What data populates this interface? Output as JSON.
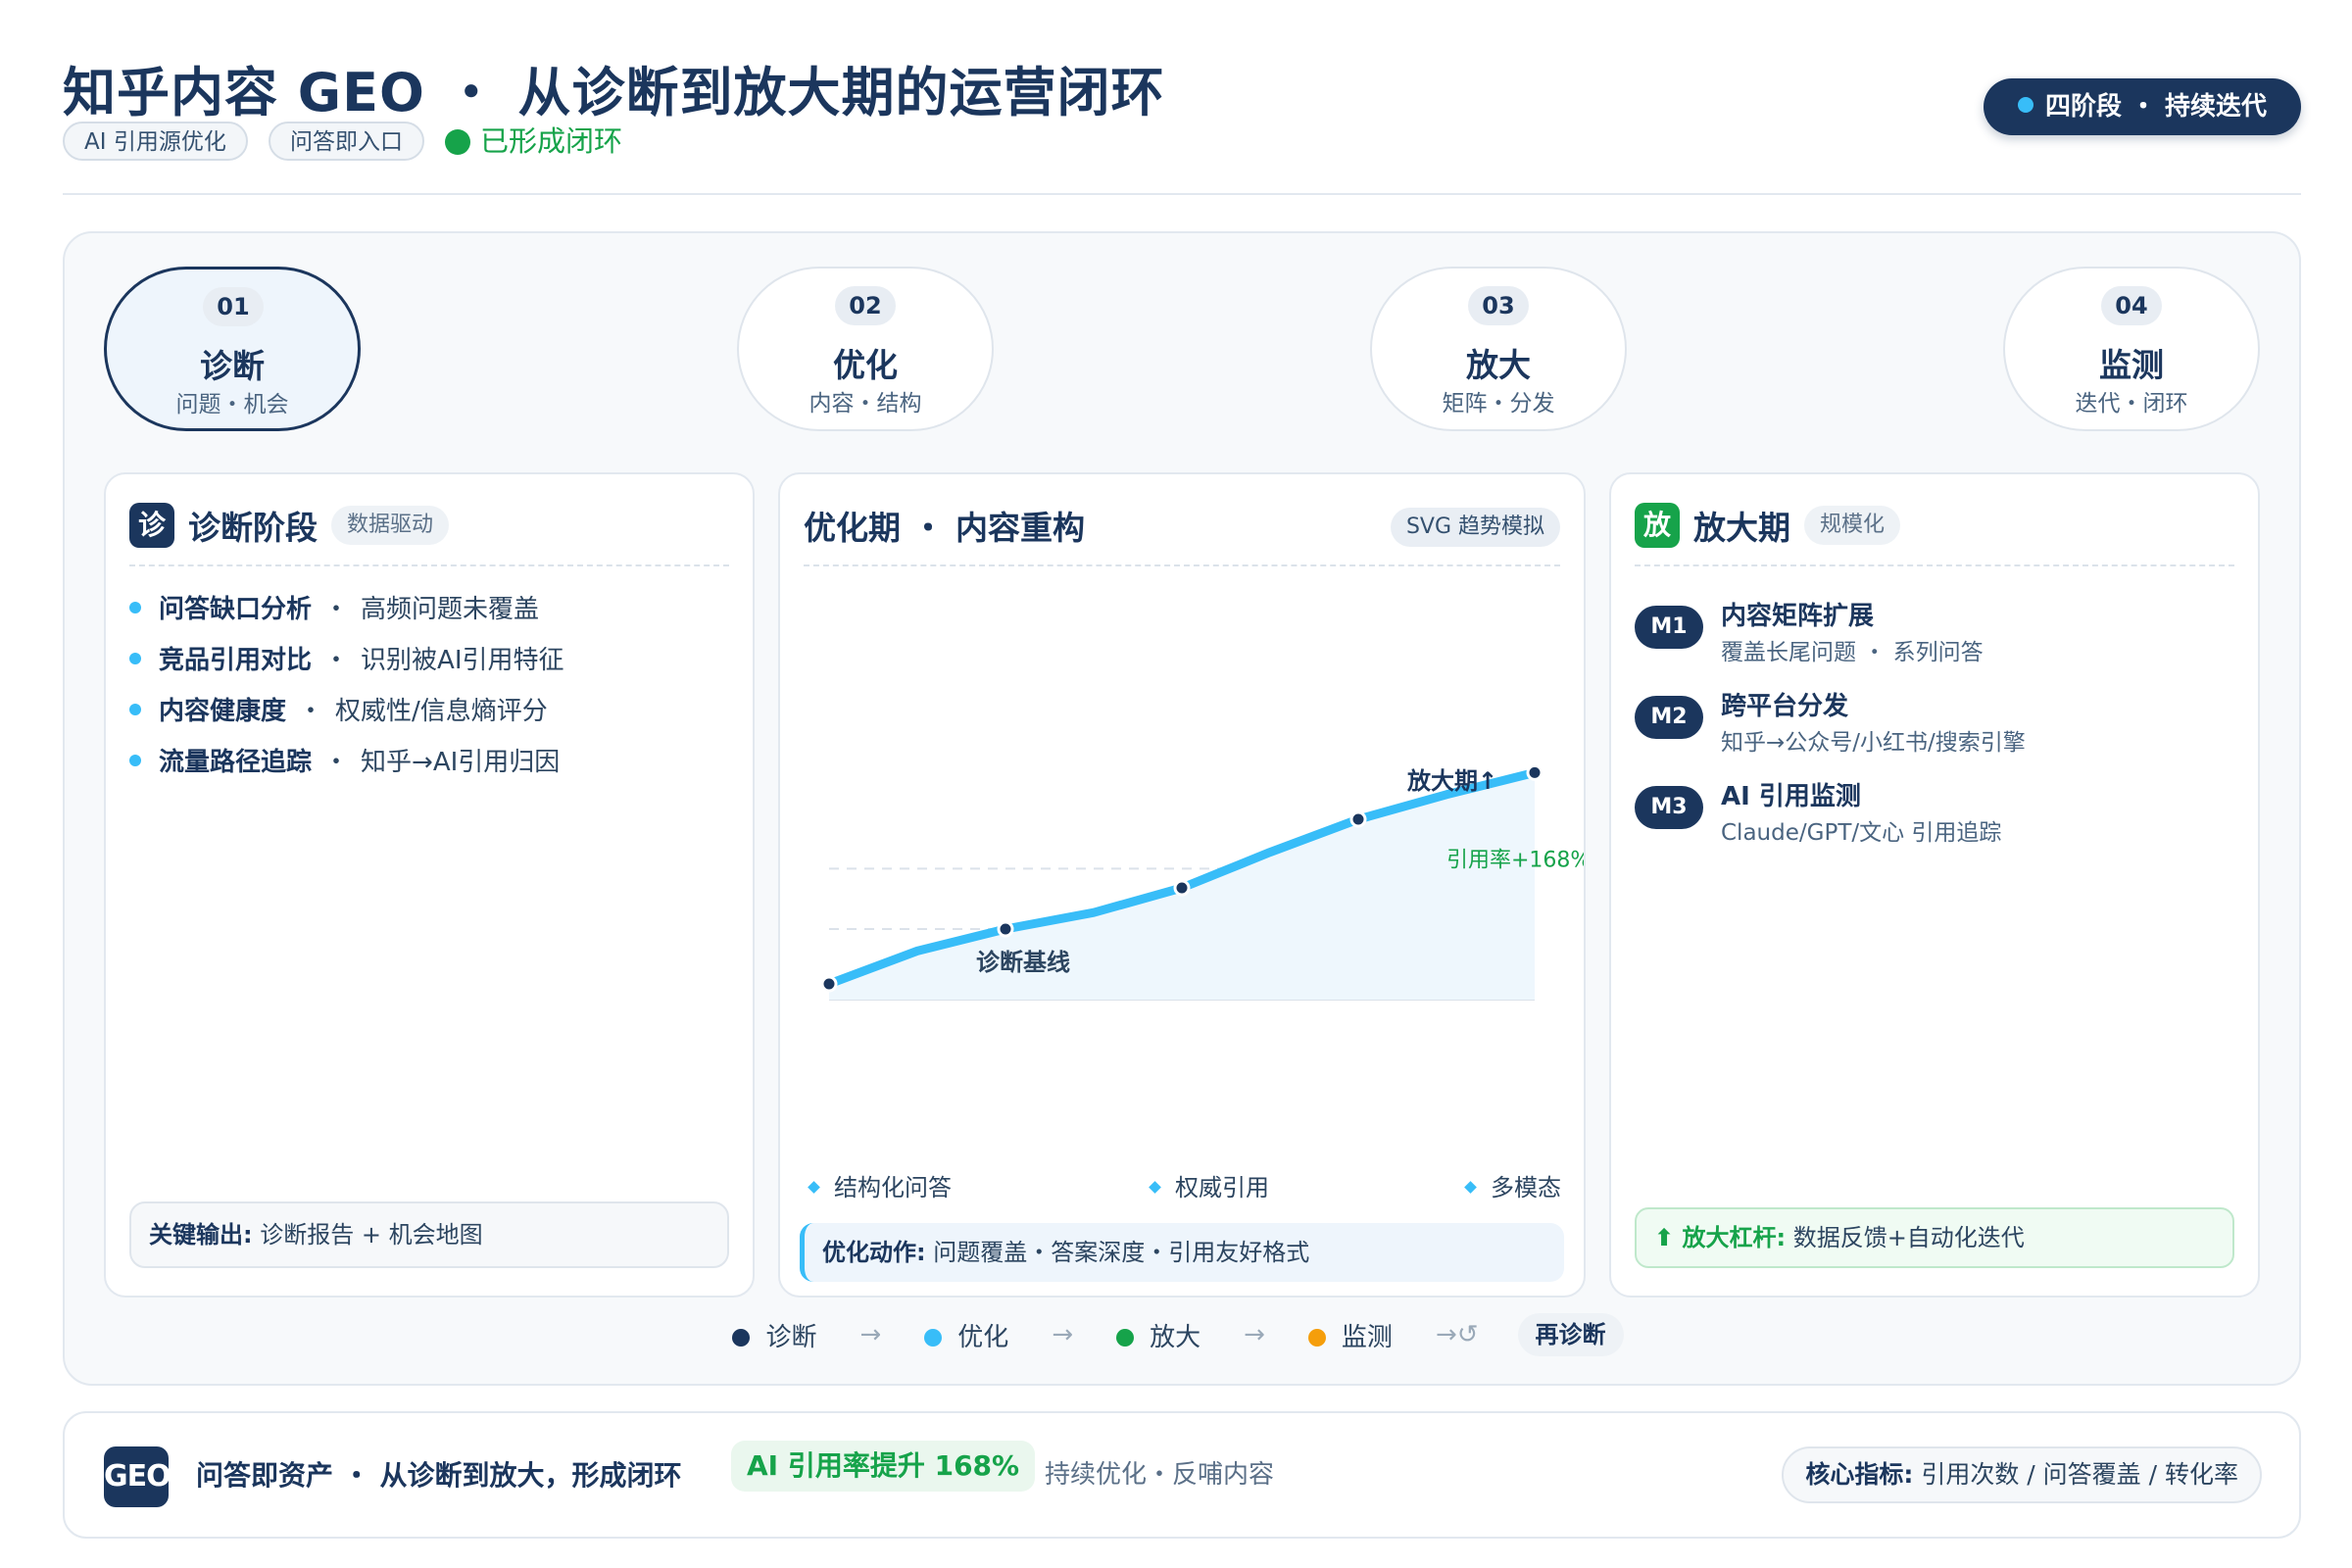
{
  "header": {
    "title": "知乎内容 GEO ・ 从诊断到放大期的运营闭环",
    "tags": [
      "AI 引用源优化",
      "问答即入口"
    ],
    "status": "已形成闭环",
    "pill": "四阶段 ・ 持续迭代"
  },
  "stages": [
    {
      "num": "01",
      "name": "诊断",
      "sub": "问题・机会"
    },
    {
      "num": "02",
      "name": "优化",
      "sub": "内容・结构"
    },
    {
      "num": "03",
      "name": "放大",
      "sub": "矩阵・分发"
    },
    {
      "num": "04",
      "name": "监测",
      "sub": "迭代・闭环"
    }
  ],
  "diagnosis": {
    "badge": "诊",
    "title": "诊断阶段",
    "chip": "数据驱动",
    "items": [
      {
        "label": "问答缺口分析",
        "sep": "・",
        "desc": "高频问题未覆盖"
      },
      {
        "label": "竞品引用对比",
        "sep": "・",
        "desc": "识别被AI引用特征"
      },
      {
        "label": "内容健康度",
        "sep": "・",
        "desc": "权威性/信息熵评分"
      },
      {
        "label": "流量路径追踪",
        "sep": "・",
        "desc": "知乎→AI引用归因"
      }
    ],
    "output_label": "关键输出:",
    "output_text": "诊断报告 + 机会地图"
  },
  "optimization": {
    "title": "优化期 ・ 内容重构",
    "chip": "SVG 趋势模拟",
    "legend": [
      "结构化问答",
      "权威引用",
      "多模态"
    ],
    "action_label": "优化动作:",
    "action_text": "问题覆盖・答案深度・引用友好格式"
  },
  "chart_data": {
    "type": "line",
    "x": [
      0,
      1,
      2,
      3,
      4,
      5,
      6,
      7,
      8
    ],
    "series": [
      {
        "values": [
          0.0,
          0.12,
          0.2,
          0.26,
          0.35,
          0.48,
          0.6,
          0.69,
          0.77
        ]
      }
    ],
    "marked_points": [
      0,
      2,
      4,
      6,
      8
    ],
    "annotations": [
      {
        "text": "诊断基线",
        "at": 2
      },
      {
        "text": "放大期↑",
        "at": 7
      },
      {
        "text": "引用率+168%",
        "at": 8
      }
    ],
    "line_color": "#38bdf8",
    "grid": "dashed horizontal"
  },
  "amplification": {
    "badge": "放",
    "title": "放大期",
    "chip": "规模化",
    "items": [
      {
        "badge": "M1",
        "title": "内容矩阵扩展",
        "sub": "覆盖长尾问题 ・ 系列问答"
      },
      {
        "badge": "M2",
        "title": "跨平台分发",
        "sub": "知乎→公众号/小红书/搜索引擎"
      },
      {
        "badge": "M3",
        "title": "AI 引用监测",
        "sub": "Claude/GPT/文心 引用追踪"
      }
    ],
    "lever_label": "⬆ 放大杠杆:",
    "lever_text": "数据反馈+自动化迭代"
  },
  "flow": {
    "steps": [
      {
        "label": "诊断",
        "color": "#1b365d"
      },
      {
        "label": "优化",
        "color": "#38bdf8"
      },
      {
        "label": "放大",
        "color": "#16a34a"
      },
      {
        "label": "监测",
        "color": "#f59e0b"
      }
    ],
    "arrow": "→",
    "loop_arrow": "→↺",
    "restart": "再诊断"
  },
  "footer": {
    "logo": "GEO",
    "main": "问答即资产 ・ 从诊断到放大，形成闭环",
    "highlight": "AI 引用率提升 168%",
    "secondary": "持续优化・反哺内容",
    "metric_label": "核心指标:",
    "metric_text": "引用次数 / 问答覆盖 / 转化率"
  },
  "colors": {
    "navy": "#1b365d",
    "sky": "#38bdf8",
    "green": "#16a34a",
    "amber": "#f59e0b"
  }
}
